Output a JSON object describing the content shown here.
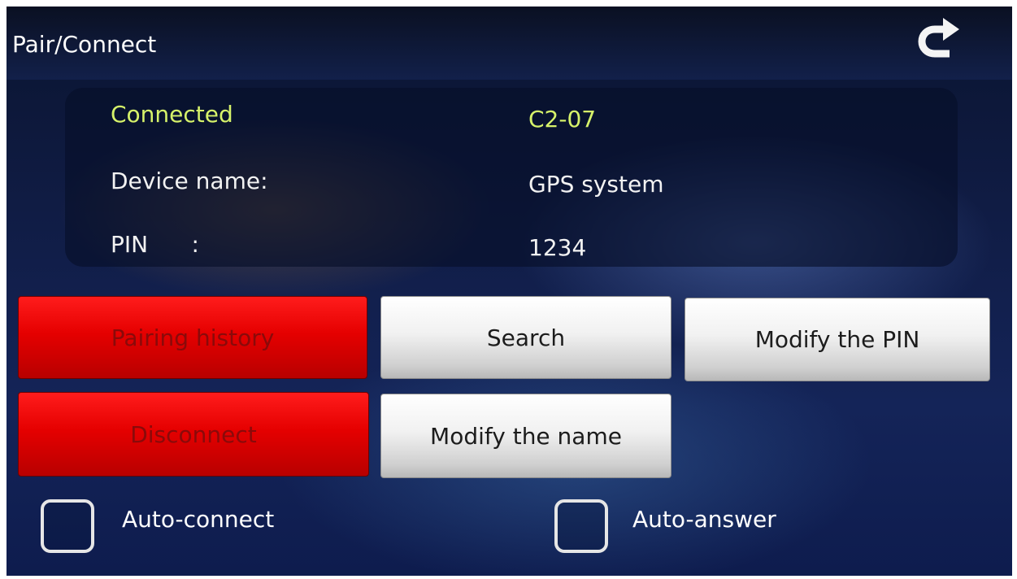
{
  "header": {
    "title": "Pair/Connect",
    "back_icon": "return-arrow-icon"
  },
  "info": {
    "status_label": "Connected",
    "status_value": "C2-07",
    "device_name_label": "Device name:",
    "device_name_value": "GPS system",
    "pin_label": "PIN      :",
    "pin_value": "1234"
  },
  "buttons": {
    "pairing_history": "Pairing history",
    "search": "Search",
    "modify_pin": "Modify the PIN",
    "disconnect": "Disconnect",
    "modify_name": "Modify the name"
  },
  "options": {
    "auto_connect": {
      "label": "Auto-connect",
      "checked": false
    },
    "auto_answer": {
      "label": "Auto-answer",
      "checked": false
    }
  },
  "colors": {
    "accent_text": "#d6f26a",
    "danger_button": "#e50000",
    "neutral_button": "#f1f1f1",
    "background": "#142458"
  }
}
